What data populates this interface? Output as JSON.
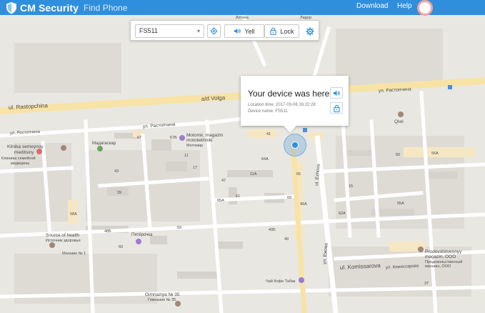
{
  "header": {
    "brand": "CM Security",
    "subbrand": "Find Phone",
    "download_label": "Download",
    "help_label": "Help",
    "background_color": "#2f8fdd"
  },
  "toolbar": {
    "device_selected": "FS511",
    "yell_label": "Yell",
    "lock_label": "Lock",
    "icons": [
      "locate-icon",
      "speaker-icon",
      "lock-icon",
      "gear-icon"
    ]
  },
  "popup": {
    "title": "Your device was here",
    "location_time": "Location time: 2017-03-06 16:22:28",
    "device_name": "Device name: FS511",
    "icons": [
      "speaker-icon",
      "lock-icon"
    ]
  },
  "map": {
    "streets": [
      "ul. Rastopchina",
      "a/d Volga",
      "ул. Растопчина",
      "ул. Ростопчина",
      "ул. Растопчина",
      "ul. Ezhova",
      "ул. Ежова",
      "ul. Komissarova",
      "ул. Комиссарова"
    ],
    "places": [
      "Klinika semeynoy meditsiny",
      "Клиника семейной медицины",
      "Мадагаскар",
      "Motomir, magazin mototekhniki",
      "Мотомир",
      "Qiwi",
      "Source of health",
      "Источник здоровья",
      "Магазин № 1",
      "Пятёрочка",
      "Prodovolstvennyy magazin, OOO",
      "Продовольственный магазин, ООО",
      "Чай Кофе Табак",
      "Gimnaziya № 35",
      "Гимназия № 35",
      "Аптека",
      "Лидер"
    ],
    "house_numbers": [
      "41",
      "67Б",
      "67",
      "11",
      "64А",
      "17",
      "11А",
      "43",
      "39",
      "51",
      "65",
      "69",
      "47",
      "50",
      "56А",
      "58А",
      "48Б",
      "60",
      "59",
      "65А",
      "49Б",
      "49",
      "15",
      "55А",
      "62А",
      "49А",
      "37"
    ],
    "colors": {
      "land": "#e9e7e2",
      "road": "#ffffff",
      "major_road": "#f8e3a6",
      "building": "#d7d4cf",
      "marker": "#2f8fdd",
      "poi": "#9c7bd1"
    }
  }
}
